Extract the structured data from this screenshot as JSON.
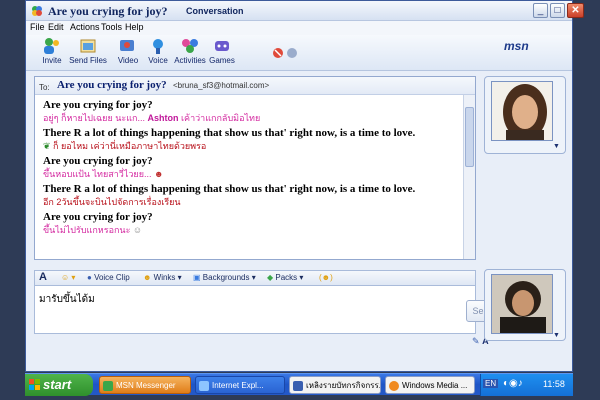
{
  "window": {
    "title": "Are you crying for joy?",
    "subtitle": "Conversation"
  },
  "menu": [
    "File",
    "Edit",
    "Actions",
    "Tools",
    "Help"
  ],
  "toolbar": {
    "items": [
      {
        "label": "Invite",
        "icon": "invite-icon"
      },
      {
        "label": "Send Files",
        "icon": "send-files-icon"
      },
      {
        "label": "Video",
        "icon": "video-icon"
      },
      {
        "label": "Voice",
        "icon": "voice-icon"
      },
      {
        "label": "Activities",
        "icon": "activities-icon"
      },
      {
        "label": "Games",
        "icon": "games-icon"
      }
    ],
    "logo": "msn"
  },
  "to": {
    "label": "To:",
    "name": "Are you crying for joy?",
    "email": "<bruna_sf3@hotmail.com>"
  },
  "messages": [
    {
      "sender": "Are you crying for joy?",
      "text": "อยู่ๆ ก็หายไปเฉยย นะแก... ",
      "highlight": "Ashton",
      "tail": " เค้าว่าแกกลับมิอไทย",
      "color": "pink"
    },
    {
      "sender": "There R a lot of things happening that show us that' right now, is a time to love.",
      "text": "ก็ ยอไหม เค่ว่านี่เหมือภาษาไทยด้วยพรอ",
      "color": "red"
    },
    {
      "sender": "Are you crying for joy?",
      "text": "ขึ้นหอบแป้น ไทยสาวี่ไวยย...",
      "color": "pink"
    },
    {
      "sender": "There R a lot of things happening that show us that' right now, is a time to love.",
      "text": "อีก 2วันขึ้นจะบินไปจัดการเรื่องเรียน",
      "color": "red"
    },
    {
      "sender": "Are you crying for joy?",
      "text": "ขึ้นไม่ไปรับแกหรอกนะ",
      "color": "pink"
    }
  ],
  "format_bar": {
    "font_icon": "A",
    "voice_clip": "Voice Clip",
    "winks": "Winks",
    "backgrounds": "Backgrounds",
    "packs": "Packs"
  },
  "input": {
    "value": "มารับขึ้นได้ม"
  },
  "send_label": "Send",
  "taskbar": {
    "start": "start",
    "tasks": [
      {
        "label": "MSN Messenger",
        "active": true
      },
      {
        "label": "Internet Expl...",
        "active": false
      },
      {
        "label": "เหลิงรายบัทกรกิจกรร...",
        "active": false
      },
      {
        "label": "Windows Media ...",
        "active": false
      }
    ],
    "lang": "EN",
    "clock": "11:58"
  },
  "colors": {
    "accent": "#10255e",
    "pink": "#d42aa0",
    "red": "#b8101a"
  }
}
